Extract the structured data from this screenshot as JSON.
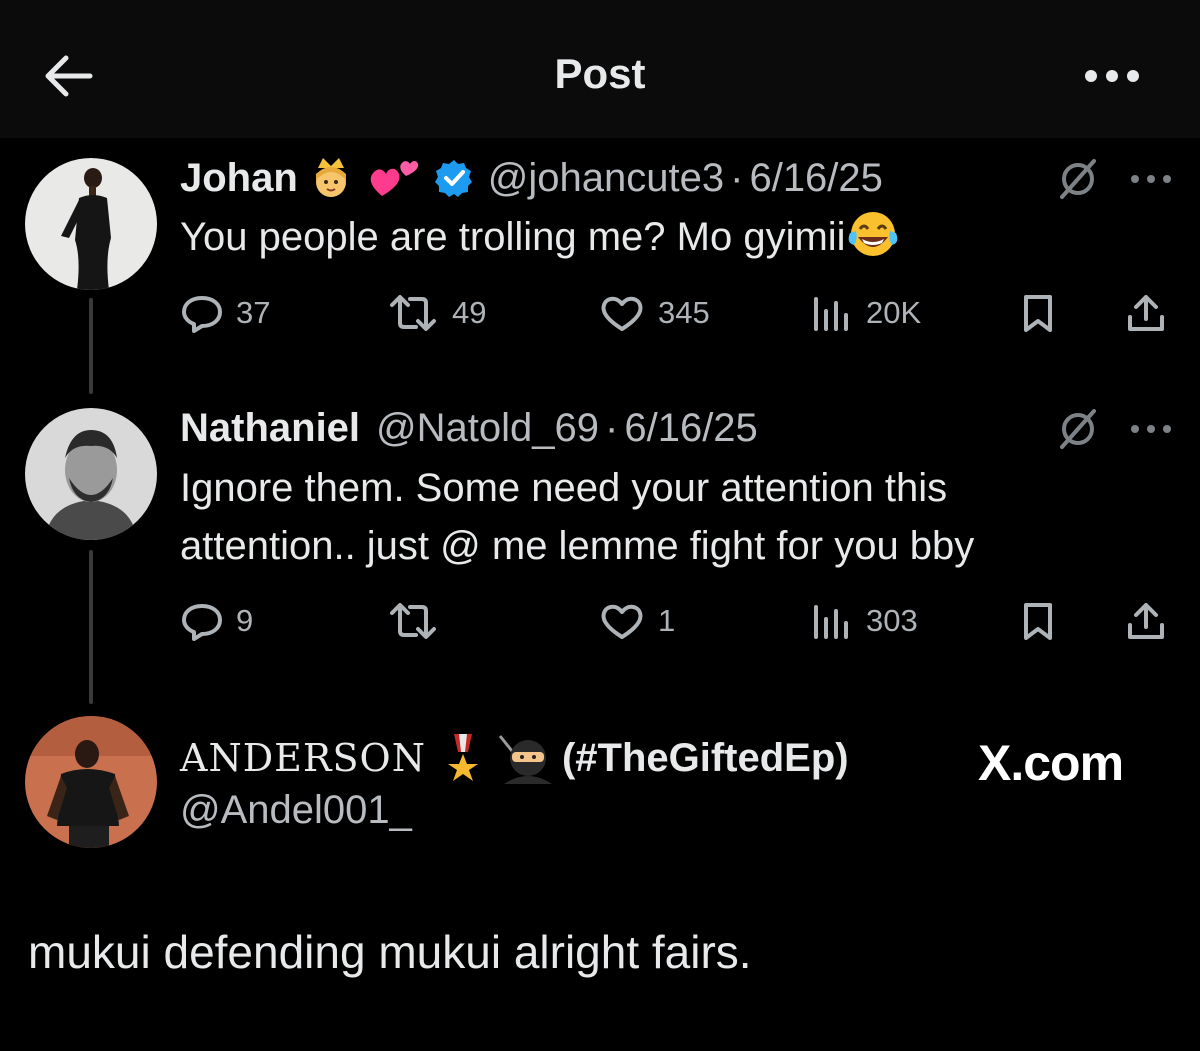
{
  "header": {
    "title": "Post",
    "back_icon": "arrow-left-icon",
    "more_icon": "more-horizontal-icon"
  },
  "colors": {
    "background": "#000000",
    "header_bg": "#0b0b0b",
    "text_primary": "#e7e9ea",
    "text_secondary": "#b8bcc0",
    "verified_blue": "#1d9bf0",
    "thread_line": "#3a3a3a"
  },
  "tweets": [
    {
      "name": "Johan",
      "name_emojis": [
        "princess-emoji",
        "two-hearts-emoji"
      ],
      "verified": true,
      "handle": "@johancute3",
      "separator": "·",
      "date": "6/16/25",
      "text": "You people are trolling me? Mo gyimii",
      "text_emoji": "tears-of-joy-emoji",
      "replies": "37",
      "reposts": "49",
      "likes": "345",
      "views": "20K"
    },
    {
      "name": "Nathaniel",
      "verified": false,
      "handle": "@Natold_69",
      "separator": "·",
      "date": "6/16/25",
      "text_line1": "Ignore them. Some need your attention this",
      "text_line2": "attention.. just @ me lemme fight for you bby",
      "replies": "9",
      "reposts": "",
      "likes": "1",
      "views": "303"
    }
  ],
  "quote_author": {
    "name": "ANDERSON",
    "name_emojis": [
      "military-medal-emoji",
      "ninja-emoji"
    ],
    "tag": "(#TheGiftedEp)",
    "handle": "@Andel001_",
    "watermark": "X.com"
  },
  "final_text": "mukui defending mukui alright fairs."
}
